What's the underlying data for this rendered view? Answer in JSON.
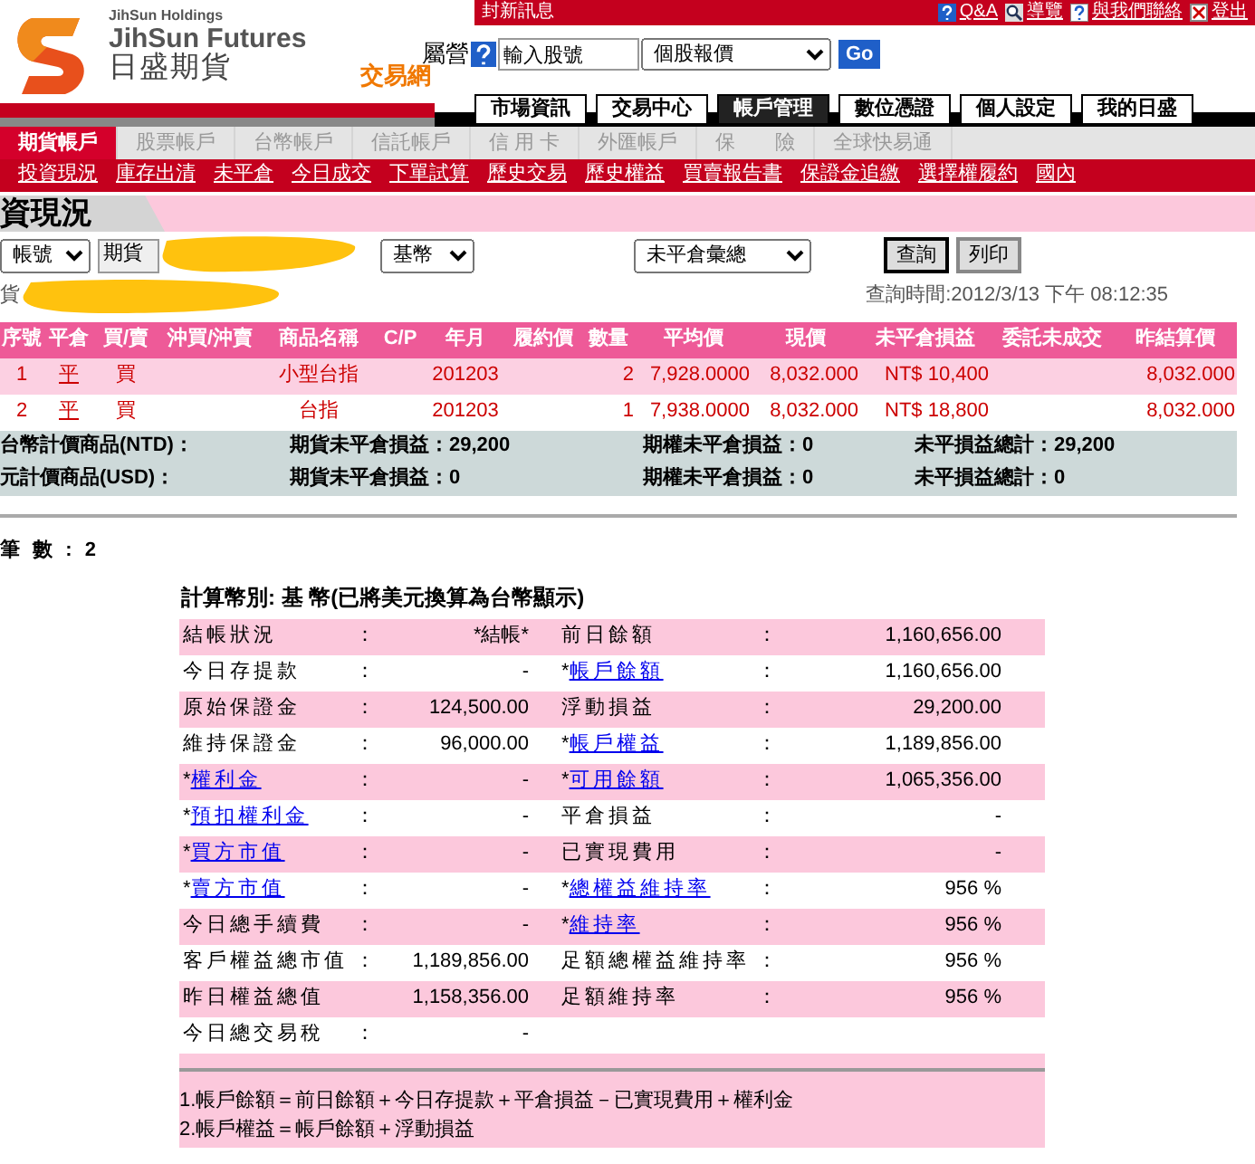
{
  "header": {
    "brand": {
      "group": "JihSun Holdings",
      "name": "JihSun Futures",
      "name_zh": "日盛期貨"
    },
    "site_label": "交易網",
    "notice": "封新訊息",
    "top_links": [
      "Q&A",
      "導覽",
      "與我們聯絡",
      "登出"
    ],
    "quote": {
      "label": "屬營",
      "value": "輸入股號",
      "select": "個股報價",
      "button": "Go"
    }
  },
  "main_tabs": [
    {
      "label": "市場資訊",
      "selected": false
    },
    {
      "label": "交易中心",
      "selected": false
    },
    {
      "label": "帳戶管理",
      "selected": true
    },
    {
      "label": "數位憑證",
      "selected": false
    },
    {
      "label": "個人設定",
      "selected": false
    },
    {
      "label": "我的日盛",
      "selected": false
    }
  ],
  "account_tabs": [
    {
      "label": "期貨帳戶",
      "selected": true
    },
    {
      "label": "股票帳戶",
      "selected": false
    },
    {
      "label": "台幣帳戶",
      "selected": false
    },
    {
      "label": "信託帳戶",
      "selected": false
    },
    {
      "label": "信 用 卡",
      "selected": false
    },
    {
      "label": "外匯帳戶",
      "selected": false
    },
    {
      "label": "保　　險",
      "selected": false
    },
    {
      "label": "全球快易通",
      "selected": false
    }
  ],
  "sub_nav": [
    "投資現況",
    "庫存出清",
    "未平倉",
    "今日成交",
    "下單試算",
    "歷史交易",
    "歷史權益",
    "買賣報告書",
    "保證金追繳",
    "選擇權履約",
    "國內"
  ],
  "page_title": "資現況",
  "filters": {
    "account": "帳號",
    "account_type": "期貨",
    "currency": "基幣",
    "view": "未平倉彙總",
    "buttons": [
      "查詢",
      "列印"
    ]
  },
  "account_line": "貨",
  "query_time": "查詢時間:2012/3/13 下午 08:12:35",
  "positions": {
    "columns": [
      "序號",
      "平倉",
      "買/賣",
      "沖買/沖賣",
      "商品名稱",
      "C/P",
      "年月",
      "履約價",
      "數量",
      "平均價",
      "現價",
      "未平倉損益",
      "委託未成交",
      "昨結算價"
    ],
    "rows": [
      [
        "1",
        "平",
        "買",
        null,
        "小型台指",
        null,
        "201203",
        null,
        "2",
        "7,928.0000",
        "8,032.000",
        "NT$ 10,400",
        null,
        "8,032.000"
      ],
      [
        "2",
        "平",
        "買",
        null,
        "台指",
        null,
        "201203",
        null,
        "1",
        "7,938.0000",
        "8,032.000",
        "NT$ 18,800",
        null,
        "8,032.000"
      ]
    ]
  },
  "summary": [
    [
      "台幣計價商品(NTD)：",
      "期貨未平倉損益：29,200",
      "期權未平倉損益：0",
      "未平損益總計：29,200"
    ],
    [
      "元計價商品(USD)：",
      "期貨未平倉損益：0",
      "期權未平倉損益：0",
      "未平損益總計：0"
    ]
  ],
  "total_count": "筆 數 : 2",
  "calc_title": "計算幣別: 基 幣(已將美元換算為台幣顯示)",
  "balances": [
    {
      "left": {
        "label": "結帳狀況",
        "link": false,
        "colon": "：",
        "value": "*結帳*"
      },
      "right": {
        "label": "前日餘額",
        "link": false,
        "colon": "：",
        "value": "1,160,656.00"
      }
    },
    {
      "left": {
        "label": "今日存提款",
        "link": false,
        "colon": "：",
        "value": "-"
      },
      "right": {
        "prefix": "*",
        "label": "帳戶餘額",
        "link": true,
        "colon": "：",
        "value": "1,160,656.00"
      }
    },
    {
      "left": {
        "label": "原始保證金",
        "link": false,
        "colon": "：",
        "value": "124,500.00"
      },
      "right": {
        "label": "浮動損益",
        "link": false,
        "colon": "：",
        "value": "29,200.00"
      }
    },
    {
      "left": {
        "label": "維持保證金",
        "link": false,
        "colon": "：",
        "value": "96,000.00"
      },
      "right": {
        "prefix": "*",
        "label": "帳戶權益",
        "link": true,
        "colon": "：",
        "value": "1,189,856.00"
      }
    },
    {
      "left": {
        "prefix": "*",
        "label": "權利金",
        "link": true,
        "colon": "：",
        "value": "-"
      },
      "right": {
        "prefix": "*",
        "label": "可用餘額",
        "link": true,
        "colon": "：",
        "value": "1,065,356.00"
      }
    },
    {
      "left": {
        "prefix": "*",
        "label": "預扣權利金",
        "link": true,
        "colon": "：",
        "value": "-"
      },
      "right": {
        "label": "平倉損益",
        "link": false,
        "colon": "：",
        "value": "-"
      }
    },
    {
      "left": {
        "prefix": "*",
        "label": "買方市值",
        "link": true,
        "colon": "：",
        "value": "-"
      },
      "right": {
        "label": "已實現費用",
        "link": false,
        "colon": "：",
        "value": "-"
      }
    },
    {
      "left": {
        "prefix": "*",
        "label": "賣方市值",
        "link": true,
        "colon": "：",
        "value": "-"
      },
      "right": {
        "prefix": "*",
        "label": "總權益維持率",
        "link": true,
        "colon": "：",
        "value": "956 %"
      }
    },
    {
      "left": {
        "label": "今日總手續費",
        "link": false,
        "colon": "：",
        "value": "-"
      },
      "right": {
        "prefix": "*",
        "label": "維持率",
        "link": true,
        "colon": "：",
        "value": "956 %"
      }
    },
    {
      "left": {
        "label": "客戶權益總市值",
        "link": false,
        "colon": "：",
        "value": "1,189,856.00"
      },
      "right": {
        "label": "足額總權益維持率",
        "link": false,
        "colon": "：",
        "value": "956 %"
      }
    },
    {
      "left": {
        "label": "昨日權益總值",
        "link": false,
        "value": "1,158,356.00"
      },
      "right": {
        "label": "足額維持率",
        "link": false,
        "colon": "：",
        "value": "956 %"
      }
    },
    {
      "left": {
        "label": "今日總交易稅",
        "link": false,
        "colon": "：",
        "value": "-"
      }
    }
  ],
  "notes": [
    "1.帳戶餘額＝前日餘額＋今日存提款＋平倉損益－已實現費用＋權利金",
    "2.帳戶權益＝帳戶餘額＋浮動損益"
  ]
}
